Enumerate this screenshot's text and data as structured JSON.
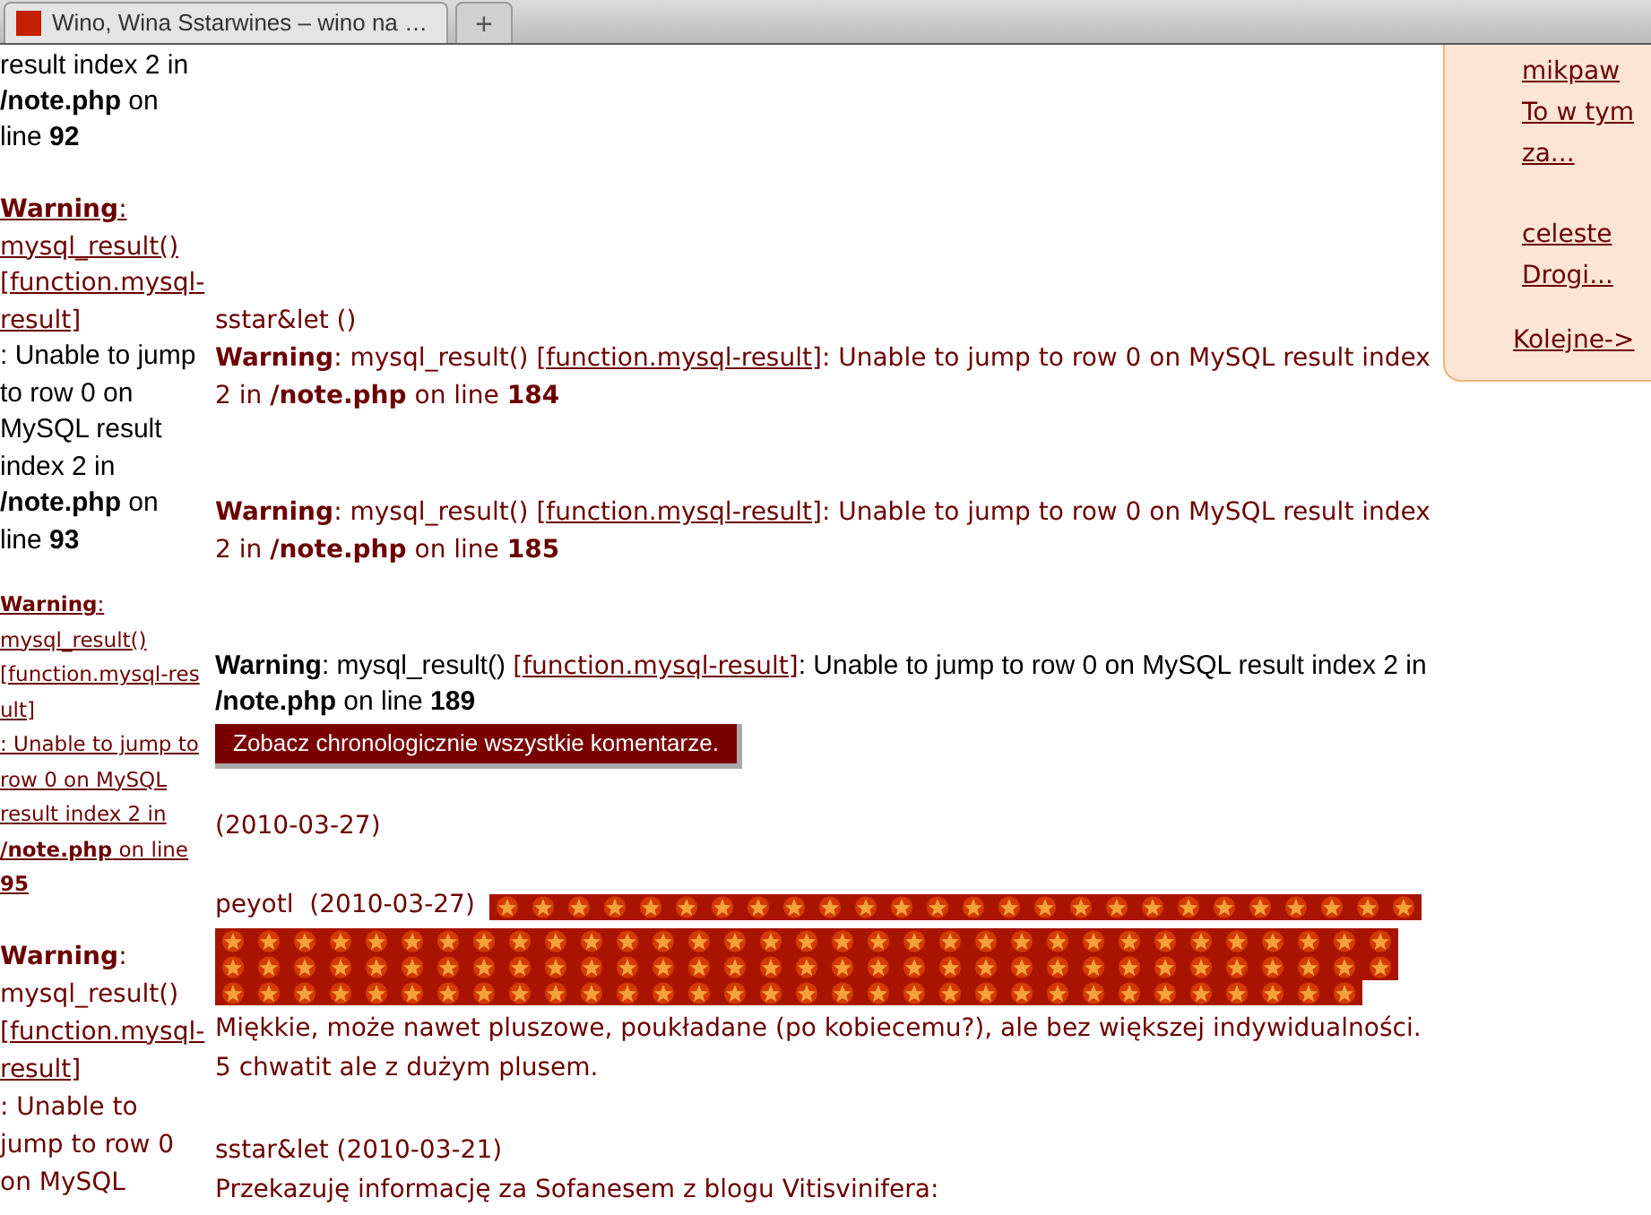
{
  "browser": {
    "tabs": [
      {
        "title": "Wino, Wina Sstarwines – wino na …",
        "selected": true
      }
    ],
    "new_tab": "+"
  },
  "left_column": [
    {
      "kind": "black",
      "before": "result index 2 in **/note.php** on line **92**"
    },
    {
      "kind": "mixed",
      "before": "**Warning**: mysql_result() ",
      "link": "[function.mysql-result]",
      "after": ": Unable to jump to row 0 on MySQL result index 2 in **/note.php** on line **93**"
    },
    {
      "kind": "small-link",
      "before": "**Warning**: mysql_result() ",
      "link": "[function.mysql-result]",
      "after": ": Unable to jump to row 0 on MySQL result index 2 in **/note.php** on line **95**"
    },
    {
      "kind": "red",
      "before": "**Warning**: mysql_result() ",
      "link": "[function.mysql-result]",
      "after": ": Unable to jump to row 0 on MySQL"
    }
  ],
  "main": [
    {
      "kind": "author",
      "text": "sstar&let ()"
    },
    {
      "kind": "warning-red",
      "before": "**Warning**: mysql_result() ",
      "link": "[function.mysql-result]",
      "after": ": Unable to jump to row 0 on MySQL result index 2 in **/note.php** on line **184**"
    },
    {
      "kind": "warning-red",
      "before": "**Warning**: mysql_result() ",
      "link": "[function.mysql-result]",
      "after": ": Unable to jump to row 0 on MySQL result index 2 in **/note.php** on line **185**"
    },
    {
      "kind": "warning-black",
      "before": "**Warning**: mysql_result() ",
      "link": "[function.mysql-result]",
      "after": ": Unable to jump to row 0 on MySQL result index 2 in **/note.php** on line **189**"
    },
    {
      "kind": "button",
      "text": "Zobacz chronologicznie wszystkie komentarze."
    },
    {
      "kind": "date",
      "text": "(2010-03-27)"
    },
    {
      "kind": "rated",
      "text": "peyotl  (2010-03-27)"
    },
    {
      "kind": "comment",
      "text": "Miękkie, może nawet pluszowe, poukładane (po kobiecemu?), ale bez większej indywidualności. 5 chwatit ale z dużym plusem."
    },
    {
      "kind": "author",
      "text": "sstar&let (2010-03-21)"
    },
    {
      "kind": "comment",
      "text": "Przekazuję informację za Sofanesem z blogu Vitisvinifera:"
    }
  ],
  "sidebar": {
    "items": [
      {
        "author": "mikpaw",
        "excerpt": [
          "To w tym",
          "za..."
        ]
      },
      {
        "author": "celeste",
        "excerpt": [
          "Drogi..."
        ]
      }
    ],
    "more": "Kolejne->"
  }
}
